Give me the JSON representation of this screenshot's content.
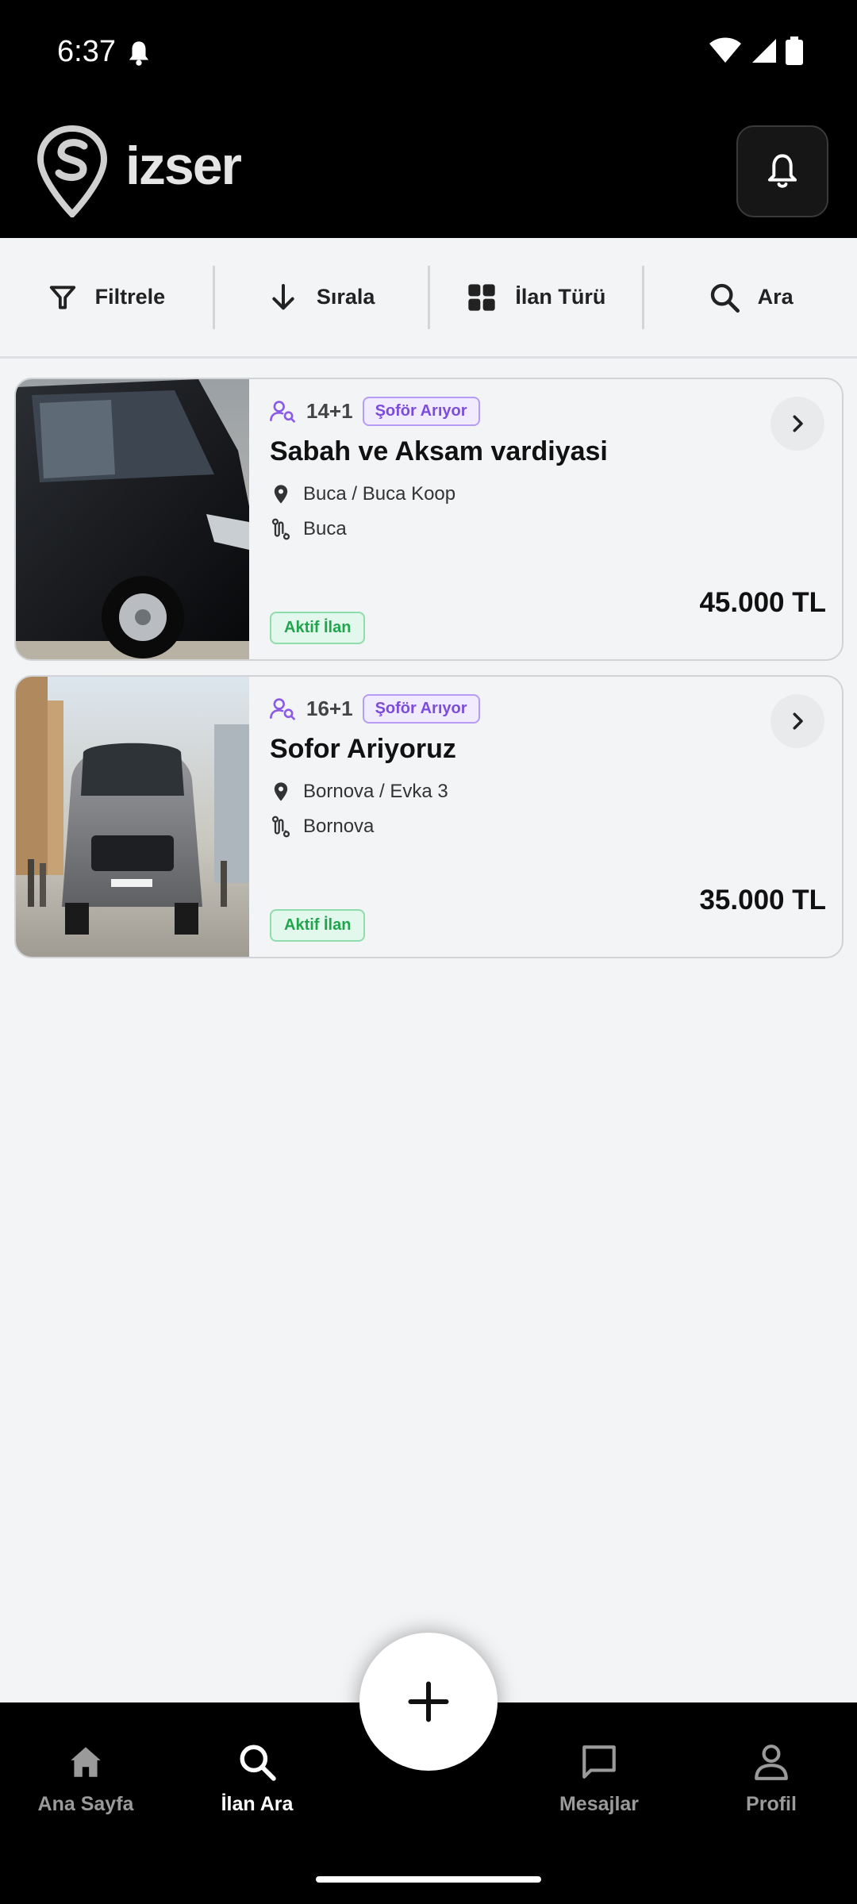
{
  "status_bar": {
    "time": "6:37"
  },
  "header": {
    "logo_text": "izser"
  },
  "toolbar": {
    "filter_label": "Filtrele",
    "sort_label": "Sırala",
    "type_label": "İlan Türü",
    "search_label": "Ara"
  },
  "listings": [
    {
      "capacity": "14+1",
      "tag": "Şoför Arıyor",
      "title": "Sabah ve Aksam vardiyasi",
      "location": "Buca / Buca Koop",
      "route": "Buca",
      "status": "Aktif İlan",
      "price": "45.000 TL"
    },
    {
      "capacity": "16+1",
      "tag": "Şoför Arıyor",
      "title": "Sofor Ariyoruz",
      "location": "Bornova / Evka 3",
      "route": "Bornova",
      "status": "Aktif İlan",
      "price": "35.000 TL"
    }
  ],
  "bottom_nav": {
    "home": "Ana Sayfa",
    "search": "İlan Ara",
    "messages": "Mesajlar",
    "profile": "Profil"
  },
  "colors": {
    "accent_purple": "#7c4ddb",
    "status_green": "#22a44f",
    "background": "#f3f4f6"
  }
}
